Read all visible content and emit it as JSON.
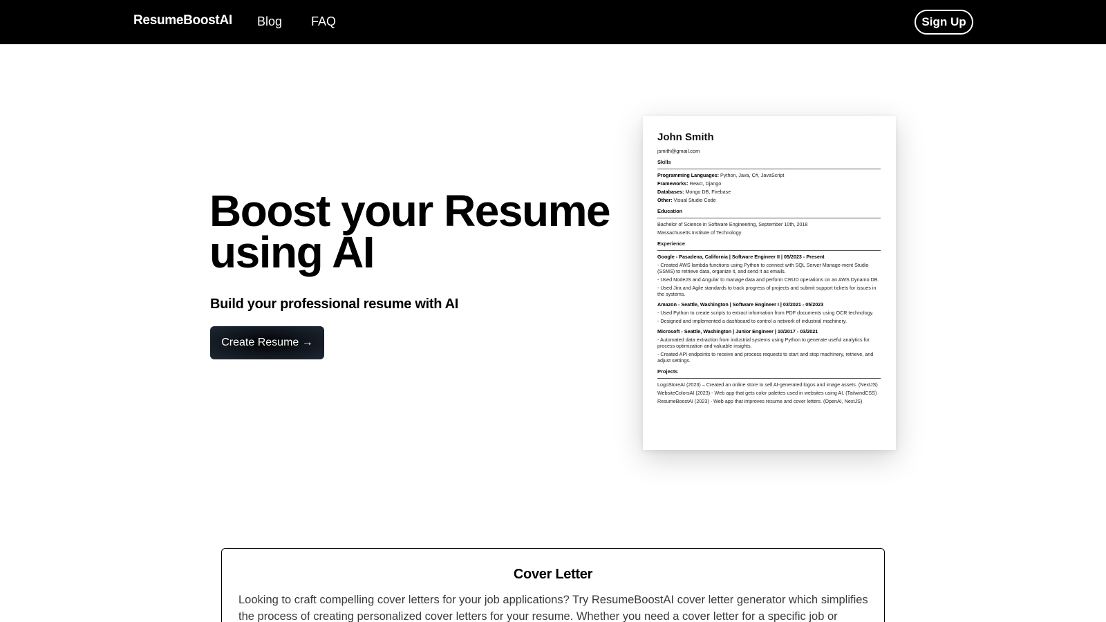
{
  "nav": {
    "brand": "ResumeBoostAI",
    "links": [
      "Blog",
      "FAQ"
    ],
    "signup_label": "Sign Up"
  },
  "hero": {
    "title_line1": "Boost your Resume",
    "title_line2": "using AI ",
    "subtitle": "Build your professional resume with AI ",
    "cta_label": "Create Resume →"
  },
  "resume": {
    "name": "John Smith",
    "email": "jsmith@gmail.com",
    "skills_heading": "Skills",
    "skills": [
      {
        "label": "Programming Languages:",
        "value": " Python, Java, C#, JavaScript"
      },
      {
        "label": "Frameworks:",
        "value": " React, Django"
      },
      {
        "label": "Databases:",
        "value": " Mongo DB, Firebase"
      },
      {
        "label": "Other:",
        "value": " Visual Studio Code"
      }
    ],
    "education_heading": "Education",
    "education": [
      "Bachelor of Science in Software Engineering, September 10th, 2018",
      "Massachusetts Institute of Technology"
    ],
    "experience_heading": "Experience",
    "jobs": [
      {
        "title": "Google - Pasadena, California | Software Engineer II | 05/2023 - Present",
        "bullets": [
          "- Created AWS lambda functions using Python to connect with SQL Server Manage-ment Studio (SSMS) to retrieve data, organize it, and send it as emails.",
          "- Used NodeJS and Angular to manage data and perform CRUD operations on an AWS Dynamo DB.",
          "- Used Jira and Agile standards to track progress of projects and submit support tickets for issues in the systems."
        ]
      },
      {
        "title": "Amazon - Seattle, Washington | Software Engineer I | 03/2021 - 05/2023",
        "bullets": [
          "- Used Python to create scripts to extract information from PDF documents using OCR technology.",
          "- Designed and implemented a dashboard to control a network of industrial machinery."
        ]
      },
      {
        "title": "Microsoft - Seattle, Washington | Junior Engineer | 10/2017 - 03/2021",
        "bullets": [
          "- Automated data extraction from industrial systems using Python to generate useful analytics for process optimization and valuable insights.",
          "- Created API endpoints to receive and process requests to start and stop machinery, retrieve, and adjust settings."
        ]
      }
    ],
    "projects_heading": "Projects",
    "projects": [
      "LogoStoreAI (2023) – Created an online store to sell AI-generated logos and image assets. (NextJS)",
      "WebsiteColorsAI (2023) - Web app that gets color palettes used in websites using AI. (TailwindCSS)",
      "ResumeBoostAI (2023) - Web app that improves resume and cover letters. (OpenAI, NextJS)"
    ]
  },
  "cover_letter": {
    "title": "Cover Letter",
    "text": "Looking to craft compelling cover letters for your job applications? Try ResumeBoostAI cover letter generator which simplifies the process of creating personalized cover letters for your resume. Whether you need a cover letter for a specific job or"
  }
}
